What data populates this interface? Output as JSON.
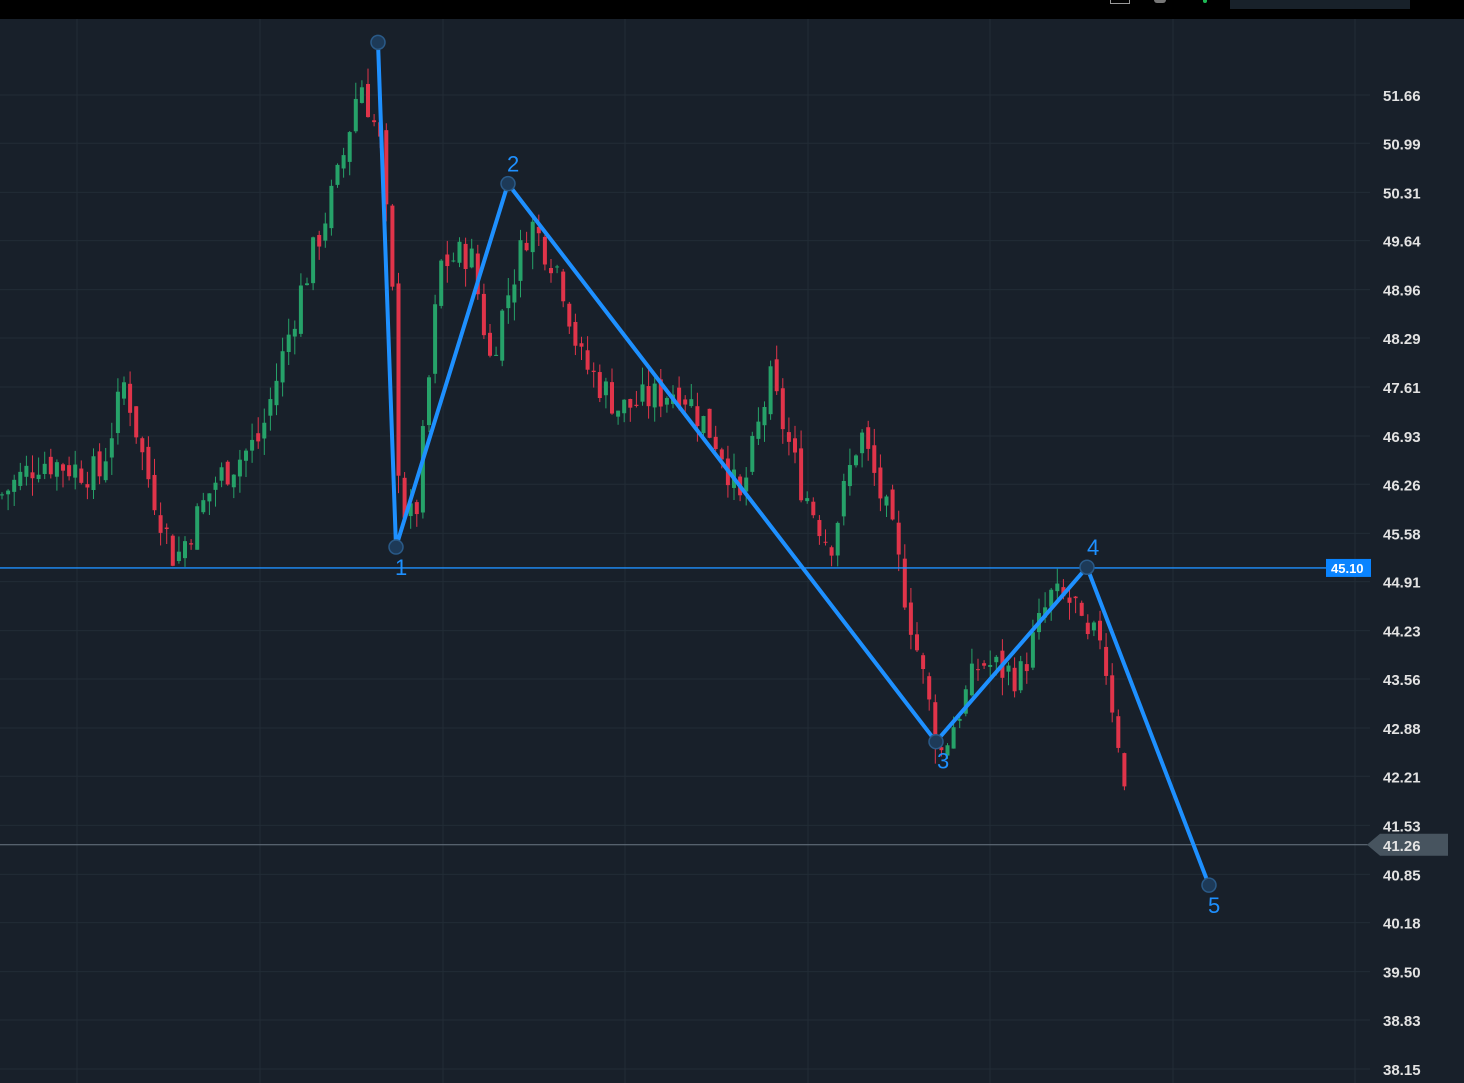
{
  "toolbar": {
    "icons": [
      "chart-icon",
      "settings-icon",
      "status-dot-icon"
    ],
    "search_placeholder": ""
  },
  "chart_data": {
    "type": "candlestick",
    "title": "",
    "y_ticks": [
      "51.66",
      "50.99",
      "50.31",
      "49.64",
      "48.96",
      "48.29",
      "47.61",
      "46.93",
      "46.26",
      "45.58",
      "44.91",
      "44.23",
      "43.56",
      "42.88",
      "42.21",
      "41.53",
      "40.85",
      "40.18",
      "39.50",
      "38.83",
      "38.15"
    ],
    "ylim": [
      38.15,
      51.66
    ],
    "horizontal_line": {
      "price": 45.1,
      "label": "45.10",
      "color": "#1e90ff"
    },
    "last_price": {
      "price": 41.26,
      "label": "41.26"
    },
    "colors": {
      "up": "#26a269",
      "down": "#e0344a",
      "wave": "#1e90ff",
      "grid": "#222c36",
      "background": "#18202a"
    },
    "close_path_anchors": [
      [
        0,
        46.1
      ],
      [
        40,
        46.6
      ],
      [
        100,
        46.4
      ],
      [
        125,
        47.7
      ],
      [
        145,
        46.5
      ],
      [
        175,
        45.2
      ],
      [
        215,
        46.3
      ],
      [
        260,
        46.9
      ],
      [
        300,
        48.9
      ],
      [
        340,
        50.6
      ],
      [
        360,
        51.9
      ],
      [
        380,
        51.0
      ],
      [
        392,
        49.0
      ],
      [
        400,
        46.0
      ],
      [
        415,
        45.7
      ],
      [
        440,
        49.3
      ],
      [
        470,
        49.5
      ],
      [
        490,
        48.0
      ],
      [
        510,
        49.0
      ],
      [
        530,
        49.9
      ],
      [
        560,
        49.2
      ],
      [
        580,
        48.0
      ],
      [
        620,
        47.3
      ],
      [
        680,
        47.6
      ],
      [
        720,
        46.8
      ],
      [
        740,
        46.0
      ],
      [
        770,
        47.7
      ],
      [
        800,
        46.3
      ],
      [
        830,
        45.4
      ],
      [
        860,
        47.0
      ],
      [
        890,
        45.7
      ],
      [
        915,
        44.1
      ],
      [
        940,
        42.5
      ],
      [
        980,
        43.8
      ],
      [
        1020,
        43.6
      ],
      [
        1050,
        44.7
      ],
      [
        1075,
        44.6
      ],
      [
        1085,
        44.0
      ],
      [
        1100,
        44.2
      ],
      [
        1120,
        42.6
      ],
      [
        1130,
        41.26
      ]
    ],
    "elliott_wave": [
      {
        "label": "",
        "price": 52.39
      },
      {
        "label": "1",
        "price": 45.39
      },
      {
        "label": "2",
        "price": 50.43
      },
      {
        "label": "3",
        "price": 42.69
      },
      {
        "label": "4",
        "price": 45.11
      },
      {
        "label": "5",
        "price": 40.7
      }
    ]
  }
}
